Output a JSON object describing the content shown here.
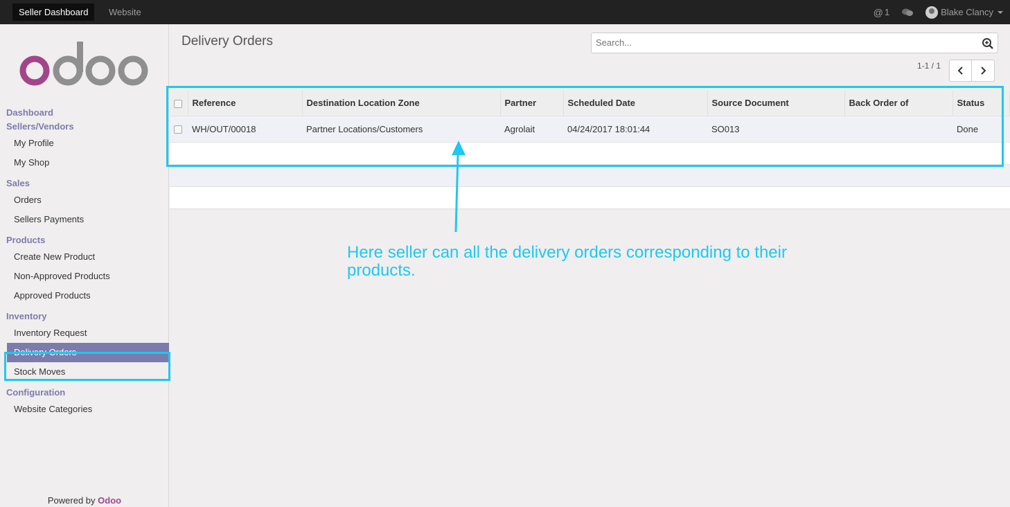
{
  "topbar": {
    "tabs": [
      "Seller Dashboard",
      "Website"
    ],
    "mentions_count": "1",
    "user_name": "Blake Clancy"
  },
  "sidebar": {
    "logo_text": "odoo",
    "sections": [
      {
        "title": "Dashboard",
        "items": []
      },
      {
        "title": "Sellers/Vendors",
        "items": [
          "My Profile",
          "My Shop"
        ]
      },
      {
        "title": "Sales",
        "items": [
          "Orders",
          "Sellers Payments"
        ]
      },
      {
        "title": "Products",
        "items": [
          "Create New Product",
          "Non-Approved Products",
          "Approved Products"
        ]
      },
      {
        "title": "Inventory",
        "items": [
          "Inventory Request",
          "Delivery Orders",
          "Stock Moves"
        ]
      },
      {
        "title": "Configuration",
        "items": [
          "Website Categories"
        ]
      }
    ],
    "active_item": "Delivery Orders",
    "powered_by_prefix": "Powered by",
    "powered_by_brand": "Odoo"
  },
  "main": {
    "title": "Delivery Orders",
    "search_placeholder": "Search...",
    "pager_text": "1-1 / 1",
    "columns": [
      "Reference",
      "Destination Location Zone",
      "Partner",
      "Scheduled Date",
      "Source Document",
      "Back Order of",
      "Status"
    ],
    "rows": [
      [
        "WH/OUT/00018",
        "Partner Locations/Customers",
        "Agrolait",
        "04/24/2017 18:01:44",
        "SO013",
        "",
        "Done"
      ]
    ]
  },
  "annotation": {
    "text": "Here seller can all the delivery orders corresponding to their products.",
    "color": "#1ec8f0"
  },
  "colors": {
    "topbar_bg": "#222222",
    "menu_accent": "#7c7bad",
    "brand_accent": "#a24689"
  }
}
